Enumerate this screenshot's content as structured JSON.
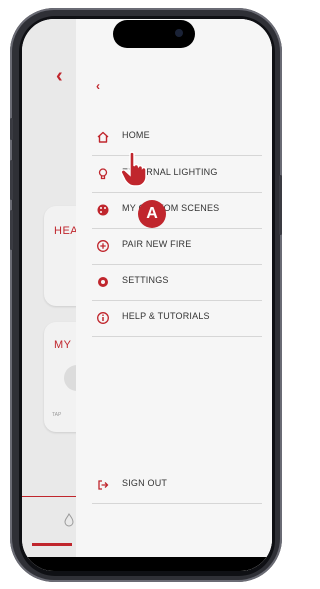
{
  "colors": {
    "accent": "#c0262d",
    "menu_bg": "#f6f6f6",
    "text": "#333333",
    "frame": "#2f3036"
  },
  "background_app": {
    "back_icon": "chevron-left-icon",
    "heading_1": "HEA",
    "heading_2": "MY",
    "tap_hint": "TAP"
  },
  "menu": {
    "back_icon": "chevron-left-icon",
    "items": [
      {
        "label": "HOME",
        "icon": "home-icon"
      },
      {
        "label": "EXTERNAL LIGHTING",
        "icon": "lightbulb-icon"
      },
      {
        "label": "MY CUSTOM SCENES",
        "icon": "palette-icon"
      },
      {
        "label": "PAIR NEW FIRE",
        "icon": "plus-circle-icon"
      },
      {
        "label": "SETTINGS",
        "icon": "gear-icon"
      },
      {
        "label": "HELP & TUTORIALS",
        "icon": "info-circle-icon"
      }
    ],
    "sign_out": {
      "label": "SIGN OUT",
      "icon": "sign-out-icon"
    }
  },
  "annotation": {
    "badge_label": "A"
  }
}
